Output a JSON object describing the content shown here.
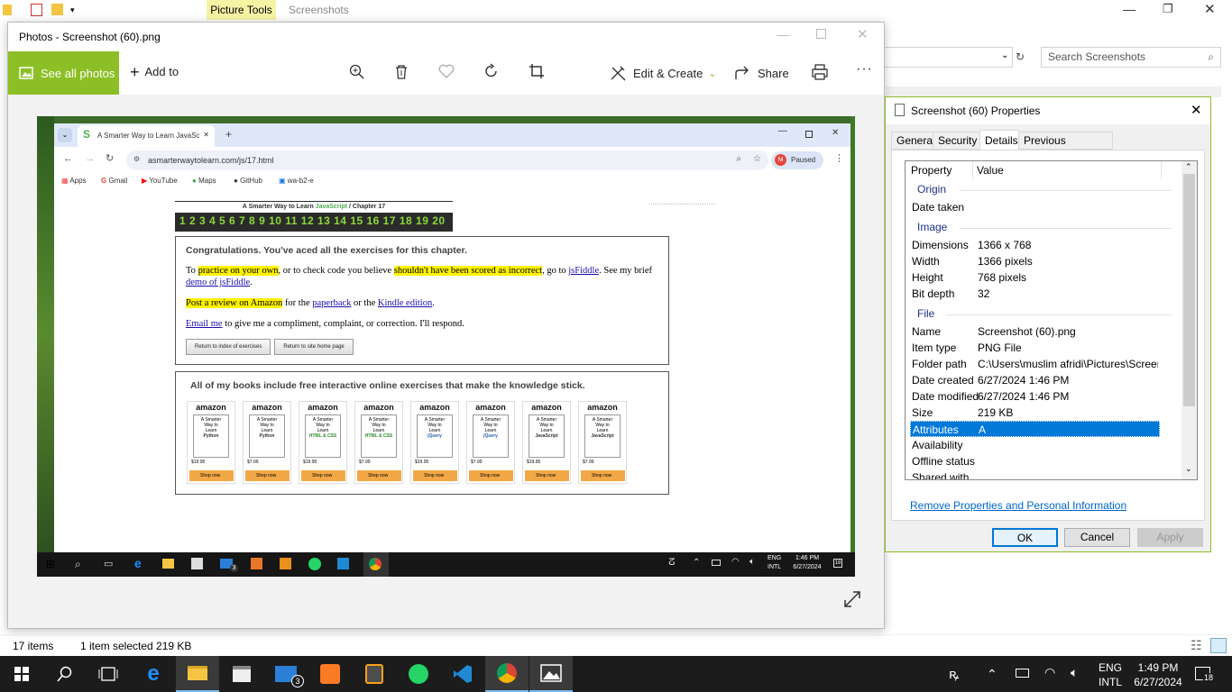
{
  "explorer": {
    "picture_tools": "Picture Tools",
    "screenshots_tab": "Screenshots",
    "search_placeholder": "Search Screenshots",
    "status_items": "17 items",
    "status_selected": "1 item selected  219 KB"
  },
  "photos": {
    "title": "Photos - Screenshot (60).png",
    "see_all": "See all photos",
    "add_to": "Add to",
    "edit_create": "Edit & Create",
    "share": "Share"
  },
  "browser": {
    "tab_title": "A Smarter Way to Learn JavaSc",
    "url": "asmarterwaytolearn.com/js/17.html",
    "paused": "Paused",
    "profile_initial": "M",
    "bookmarks": [
      "Apps",
      "Gmail",
      "YouTube",
      "Maps",
      "GitHub",
      "wa-b2-e"
    ]
  },
  "page": {
    "header_pre": "A Smarter Way to Learn ",
    "header_js": "JavaScript",
    "header_post": "  /  Chapter 17",
    "chapters": "1 2 3 4 5 6 7 8 9 10 11 12 13 14 15 16 17 18 19 20",
    "congrats": "Congratulations. You've aced all the exercises for this chapter.",
    "p1_a": "To ",
    "p1_hl1": "practice on your own",
    "p1_b": ", or to check code you believe ",
    "p1_hl2": "shouldn't have been scored as incorrect",
    "p1_c": ", go to ",
    "p1_link": "jsFiddle",
    "p1_d": ". See my brief ",
    "p1_link2": "demo of jsFiddle",
    "p1_e": ".",
    "p2_hl": "Post a review on Amazon",
    "p2_a": " for the ",
    "p2_link1": "paperback",
    "p2_b": " or the ",
    "p2_link2": "Kindle edition",
    "p2_c": ".",
    "p3_link": "Email me",
    "p3_a": " to give me a compliment, complaint, or correction. I'll respond.",
    "btn_index": "Return to index of exercises",
    "btn_home": "Return to site home page",
    "books_heading": "All of my books include free interactive online exercises that make the knowledge stick.",
    "books": [
      {
        "brand": "amazon",
        "t1": "A Smarter",
        "t2": "Way to",
        "t3": "Learn",
        "t4": "Python",
        "price": "$19.95",
        "shop": "Shop now",
        "color": "#333"
      },
      {
        "brand": "amazon",
        "t1": "A Smarter",
        "t2": "Way to",
        "t3": "Learn",
        "t4": "Python",
        "price": "$7.99",
        "shop": "Shop now",
        "color": "#333"
      },
      {
        "brand": "amazon",
        "t1": "A Smarter",
        "t2": "Way to",
        "t3": "Learn",
        "t4": "HTML & CSS",
        "price": "$19.95",
        "shop": "Shop now",
        "color": "#2a8a2a"
      },
      {
        "brand": "amazon",
        "t1": "A Smarter",
        "t2": "Way to",
        "t3": "Learn",
        "t4": "HTML & CSS",
        "price": "$7.99",
        "shop": "Shop now",
        "color": "#2a8a2a"
      },
      {
        "brand": "amazon",
        "t1": "A Smarter",
        "t2": "Way to",
        "t3": "Learn",
        "t4": "jQuery",
        "price": "$19.95",
        "shop": "Shop now",
        "color": "#2a5db0"
      },
      {
        "brand": "amazon",
        "t1": "A Smarter",
        "t2": "Way to",
        "t3": "Learn",
        "t4": "jQuery",
        "price": "$7.99",
        "shop": "Shop now",
        "color": "#2a5db0"
      },
      {
        "brand": "amazon",
        "t1": "A Smarter",
        "t2": "Way to",
        "t3": "Learn",
        "t4": "JavaScript",
        "price": "$19.95",
        "shop": "Shop now",
        "color": "#333"
      },
      {
        "brand": "amazon",
        "t1": "A Smarter",
        "t2": "Way to",
        "t3": "Learn",
        "t4": "JavaScript",
        "price": "$7.99",
        "shop": "Shop now",
        "color": "#333"
      }
    ]
  },
  "inner_taskbar": {
    "lang": "ENG",
    "kbd": "INTL",
    "time": "1:46 PM",
    "date": "6/27/2024",
    "mail_badge": "3",
    "notif": "18"
  },
  "props": {
    "title": "Screenshot (60) Properties",
    "tabs": [
      "General",
      "Security",
      "Details",
      "Previous Versions"
    ],
    "col_property": "Property",
    "col_value": "Value",
    "groups": {
      "origin": "Origin",
      "image": "Image",
      "file": "File"
    },
    "rows": {
      "date_taken": {
        "k": "Date taken",
        "v": ""
      },
      "dimensions": {
        "k": "Dimensions",
        "v": "1366 x 768"
      },
      "width": {
        "k": "Width",
        "v": "1366 pixels"
      },
      "height": {
        "k": "Height",
        "v": "768 pixels"
      },
      "bit_depth": {
        "k": "Bit depth",
        "v": "32"
      },
      "name": {
        "k": "Name",
        "v": "Screenshot (60).png"
      },
      "item_type": {
        "k": "Item type",
        "v": "PNG File"
      },
      "folder_path": {
        "k": "Folder path",
        "v": "C:\\Users\\muslim afridi\\Pictures\\Screen..."
      },
      "date_created": {
        "k": "Date created",
        "v": "6/27/2024 1:46 PM"
      },
      "date_modified": {
        "k": "Date modified",
        "v": "6/27/2024 1:46 PM"
      },
      "size": {
        "k": "Size",
        "v": "219 KB"
      },
      "attributes": {
        "k": "Attributes",
        "v": "A"
      },
      "availability": {
        "k": "Availability",
        "v": ""
      },
      "offline_status": {
        "k": "Offline status",
        "v": ""
      },
      "shared_with": {
        "k": "Shared with",
        "v": ""
      }
    },
    "remove_link": "Remove Properties and Personal Information",
    "ok": "OK",
    "cancel": "Cancel",
    "apply": "Apply"
  },
  "taskbar": {
    "lang": "ENG",
    "kbd": "INTL",
    "time": "1:49 PM",
    "date": "6/27/2024",
    "mail_badge": "3",
    "notif": "18"
  },
  "colors": {
    "accent_green": "#8cbf26",
    "selection": "#0078d7",
    "highlight": "#fff200"
  }
}
